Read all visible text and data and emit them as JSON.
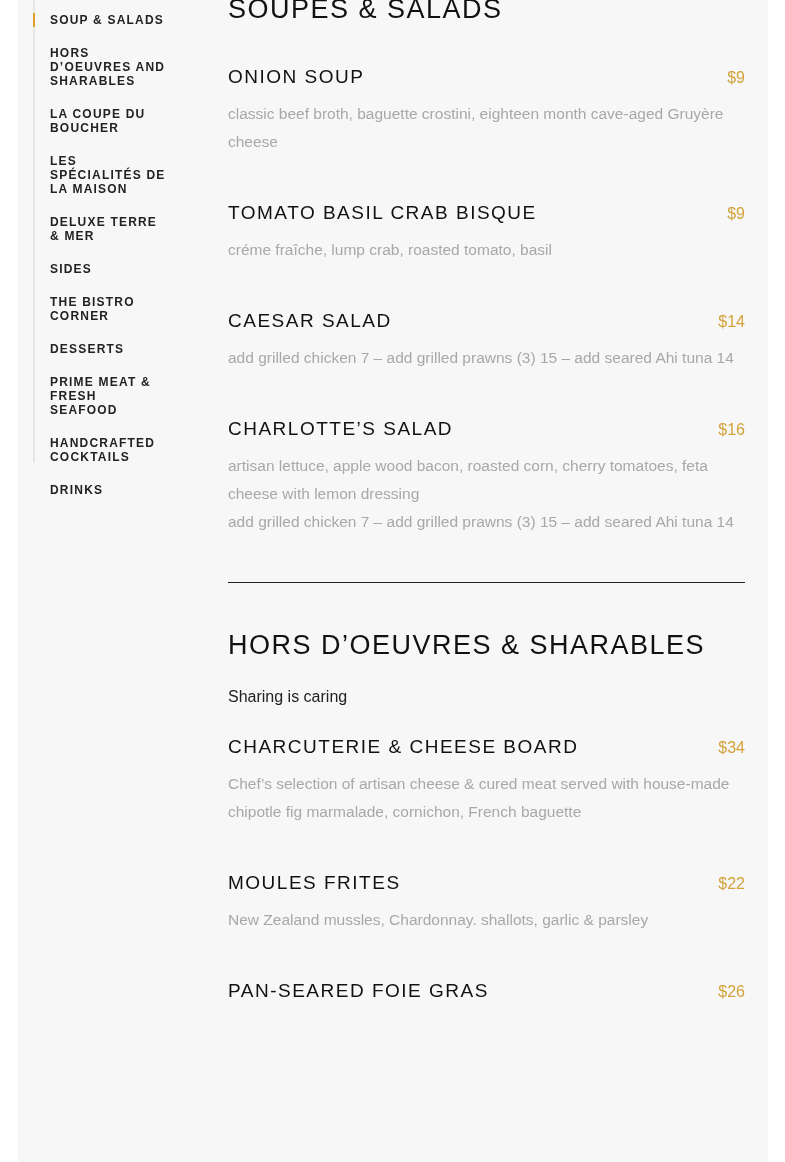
{
  "sidebar": {
    "items": [
      {
        "label": "SOUP & SALADS",
        "selected": true
      },
      {
        "label": "HORS D’OEUVRES AND SHARABLES",
        "selected": false
      },
      {
        "label": "LA COUPE DU BOUCHER",
        "selected": false
      },
      {
        "label": "LES SPÉCIALITÉS DE LA MAISON",
        "selected": false
      },
      {
        "label": "DELUXE TERRE & MER",
        "selected": false
      },
      {
        "label": "SIDES",
        "selected": false
      },
      {
        "label": "THE BISTRO CORNER",
        "selected": false
      },
      {
        "label": "DESSERTS",
        "selected": false
      },
      {
        "label": "PRIME MEAT & FRESH SEAFOOD",
        "selected": false
      },
      {
        "label": "HANDCRAFTED COCKTAILS",
        "selected": false
      },
      {
        "label": "DRINKS",
        "selected": false
      }
    ]
  },
  "sections": [
    {
      "title": "SOUPES & SALADS",
      "items": [
        {
          "name": "ONION SOUP",
          "price": "$9",
          "description": [
            "classic beef broth, baguette crostini, eighteen month cave-aged Gruyère cheese"
          ]
        },
        {
          "name": "TOMATO BASIL CRAB BISQUE",
          "price": "$9",
          "description": [
            "créme fraîche, lump crab, roasted tomato, basil"
          ]
        },
        {
          "name": "CAESAR SALAD",
          "price": "$14",
          "description": [
            "add grilled chicken 7 – add grilled prawns (3) 15 – add seared Ahi tuna 14"
          ]
        },
        {
          "name": "CHARLOTTE’S SALAD",
          "price": "$16",
          "description": [
            "artisan lettuce, apple wood bacon, roasted corn, cherry tomatoes, feta cheese with lemon dressing",
            "add grilled chicken 7 – add grilled prawns (3) 15 – add seared Ahi tuna 14"
          ]
        }
      ]
    },
    {
      "title": "HORS D’OEUVRES & SHARABLES",
      "subtitle": "Sharing is caring",
      "items": [
        {
          "name": "CHARCUTERIE & CHEESE BOARD",
          "price": "$34",
          "description": [
            "Chef’s selection of artisan cheese & cured meat served with house-made chipotle fig marmalade, cornichon, French baguette"
          ]
        },
        {
          "name": "MOULES FRITES",
          "price": "$22",
          "description": [
            "New Zealand mussles, Chardonnay. shallots, garlic & parsley"
          ]
        },
        {
          "name": "PAN-SEARED FOIE GRAS",
          "price": "$26"
        }
      ]
    }
  ]
}
